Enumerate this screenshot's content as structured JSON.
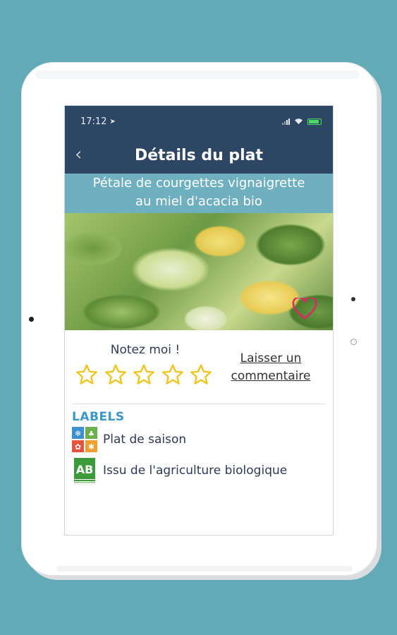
{
  "status_bar": {
    "time": "17:12"
  },
  "navbar": {
    "back_icon": "chevron-left-icon",
    "title": "Détails du plat"
  },
  "dish": {
    "name_line1": "Pétale de courgettes vignaigrette",
    "name_line2": "au miel d'acacia bio",
    "favorite_icon": "heart-outline-icon"
  },
  "rating": {
    "label": "Notez moi !",
    "max_stars": 5,
    "current": 0
  },
  "comment": {
    "line1": "Laisser un",
    "line2": "commentaire"
  },
  "labels": {
    "heading": "LABELS",
    "items": [
      {
        "icon": "seasonal-icon",
        "text": "Plat de saison"
      },
      {
        "icon": "organic-ab-icon",
        "text": "Issu de l'agriculture biologique"
      }
    ]
  },
  "colors": {
    "navbar": "#2d4663",
    "title_band": "#6fb0c0",
    "star": "#f0c419",
    "heart": "#e0256a",
    "labels_heading": "#3a98c8"
  }
}
